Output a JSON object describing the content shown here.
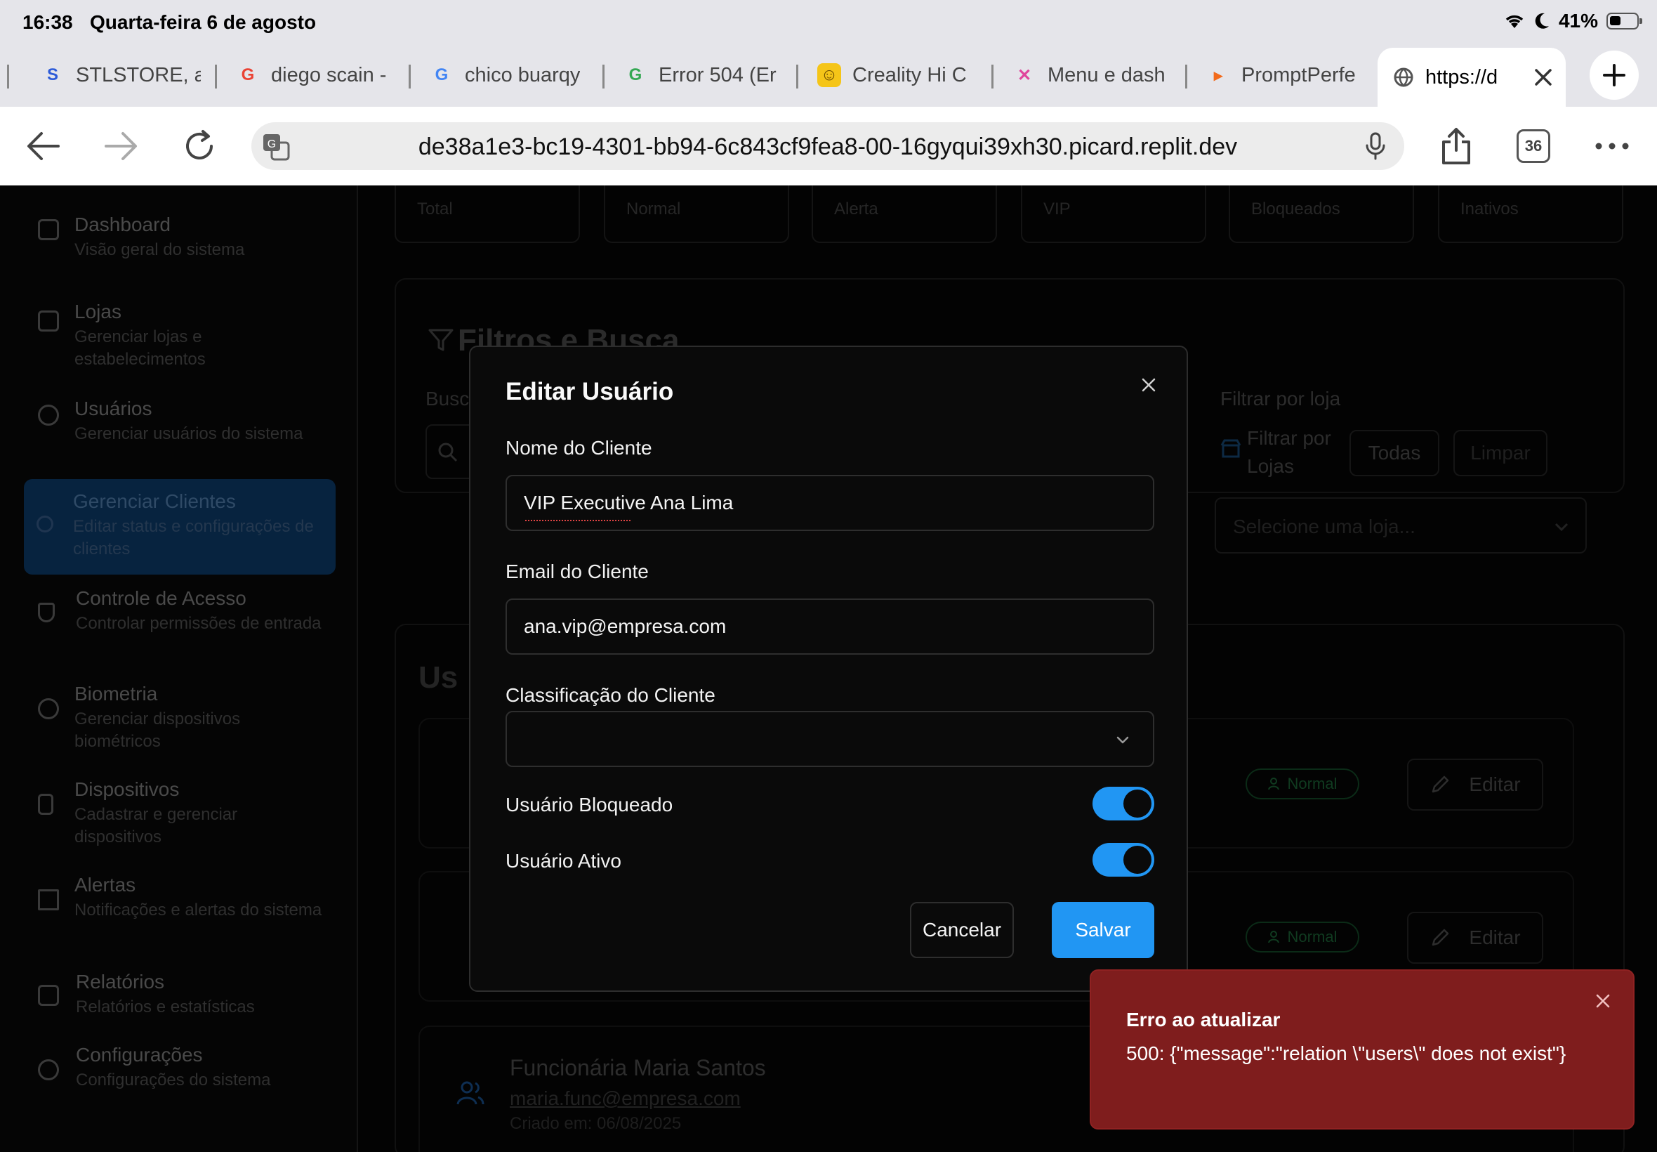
{
  "status_bar": {
    "time": "16:38",
    "date": "Quarta-feira 6 de agosto",
    "battery": "41%"
  },
  "tabs": [
    {
      "label": "STLSTORE, a",
      "icon": "stlstore-icon"
    },
    {
      "label": "diego scain -",
      "icon": "google-icon"
    },
    {
      "label": "chico buarqy",
      "icon": "google-icon"
    },
    {
      "label": "Error 504 (Er",
      "icon": "google-icon"
    },
    {
      "label": "Creality Hi C",
      "icon": "creality-icon"
    },
    {
      "label": "Menu e dash",
      "icon": "figma-icon"
    },
    {
      "label": "PromptPerfe",
      "icon": "promptperfect-icon"
    },
    {
      "label": "https://d",
      "icon": "globe-icon",
      "active": true
    }
  ],
  "browser": {
    "url": "de38a1e3-bc19-4301-bb94-6c843cf9fea8-00-16gyqui39xh30.picard.replit.dev",
    "tab_count": "36"
  },
  "sidebar": {
    "items": [
      {
        "title": "Dashboard",
        "desc": "Visão geral do sistema"
      },
      {
        "title": "Lojas",
        "desc": "Gerenciar lojas e estabelecimentos"
      },
      {
        "title": "Usuários",
        "desc": "Gerenciar usuários do sistema"
      },
      {
        "title": "Gerenciar Clientes",
        "desc": "Editar status e configurações de clientes"
      },
      {
        "title": "Controle de Acesso",
        "desc": "Controlar permissões de entrada"
      },
      {
        "title": "Biometria",
        "desc": "Gerenciar dispositivos biométricos"
      },
      {
        "title": "Dispositivos",
        "desc": "Cadastrar e gerenciar dispositivos"
      },
      {
        "title": "Alertas",
        "desc": "Notificações e alertas do sistema"
      },
      {
        "title": "Relatórios",
        "desc": "Relatórios e estatísticas"
      },
      {
        "title": "Configurações",
        "desc": "Configurações do sistema"
      }
    ]
  },
  "background": {
    "stats": [
      "Total",
      "Normal",
      "Alerta",
      "VIP",
      "Bloqueados",
      "Inativos"
    ],
    "filters_title": "Filtros e Busca",
    "search_label": "Busc",
    "store_filter_label": "Filtrar por loja",
    "store_filter_button": "Filtrar por Lojas",
    "all_button": "Todas",
    "clear_button": "Limpar",
    "store_select_placeholder": "Selecione uma loja...",
    "users_heading": "Us",
    "badge_normal": "Normal",
    "edit_button": "Editar",
    "user_name": "Funcionária Maria Santos",
    "user_email": "maria.func@empresa.com",
    "user_created": "Criado em: 06/08/2025"
  },
  "modal": {
    "title": "Editar Usuário",
    "name_label": "Nome do Cliente",
    "name_value": "VIP Executive Ana Lima",
    "email_label": "Email do Cliente",
    "email_value": "ana.vip@empresa.com",
    "classification_label": "Classificação do Cliente",
    "classification_value": "",
    "blocked_label": "Usuário Bloqueado",
    "blocked_on": true,
    "active_label": "Usuário Ativo",
    "active_on": true,
    "cancel_label": "Cancelar",
    "save_label": "Salvar"
  },
  "toast": {
    "title": "Erro ao atualizar",
    "message": "500: {\"message\":\"relation \\\"users\\\" does not exist\"}"
  },
  "colors": {
    "accent": "#2196f3",
    "error": "#7f1d1d",
    "active_sidebar": "#07233f"
  }
}
